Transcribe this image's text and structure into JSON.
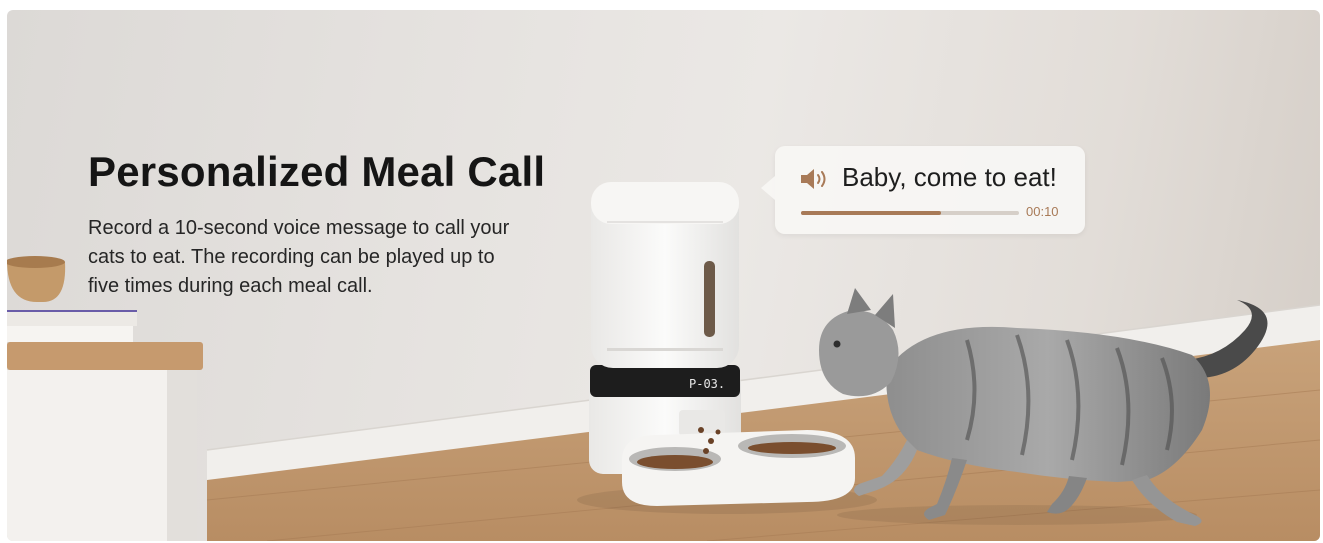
{
  "headline": "Personalized Meal Call",
  "description": "Record a 10-second voice message to call your cats to eat. The recording can be played up to five times during each meal call.",
  "voice_bubble": {
    "text": "Baby, come to eat!",
    "time": "00:10",
    "progress": 0.64,
    "accent_color": "#a87a57",
    "icon": "speaker-icon"
  },
  "feeder_display": "P-03."
}
